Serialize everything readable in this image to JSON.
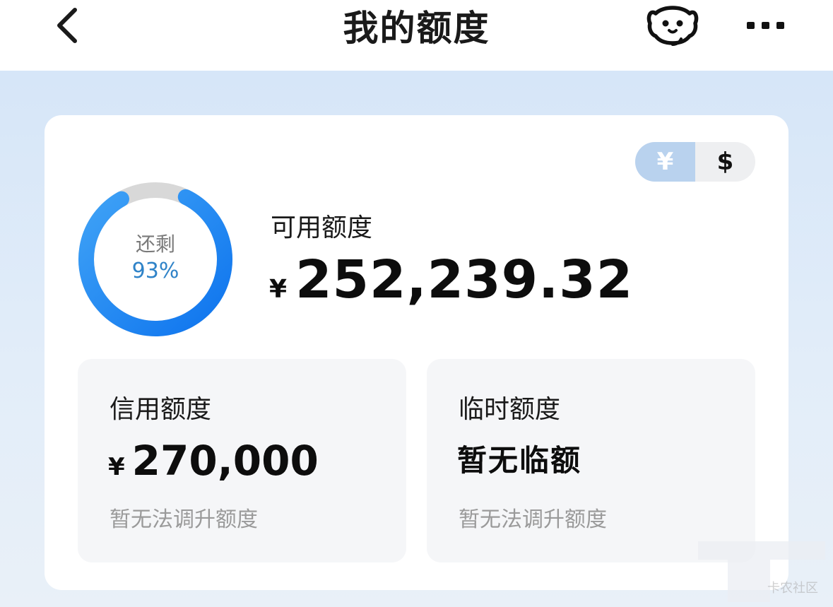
{
  "navbar": {
    "title": "我的额度",
    "back_icon": "chevron-left-icon",
    "service_icon": "customer-service-icon",
    "more_icon": "more-dots-icon"
  },
  "currency_toggle": {
    "options": [
      "¥",
      "$"
    ],
    "selected": "¥"
  },
  "usage_ring": {
    "label": "还剩",
    "percent_text": "93%",
    "remaining_fraction": 0.93,
    "progress_color": "#1f8af2",
    "track_color": "#d8d8d8"
  },
  "available": {
    "label": "可用额度",
    "currency": "¥",
    "amount": "252,239.32"
  },
  "credit_limit": {
    "label": "信用额度",
    "currency": "¥",
    "amount": "270,000",
    "hint": "暂无法调升额度"
  },
  "temp_limit": {
    "label": "临时额度",
    "value": "暂无临额",
    "hint": "暂无法调升额度"
  },
  "watermark": "卡农社区",
  "colors": {
    "accent": "#1f8af2",
    "toggle_active": "#b9d2ee",
    "background": "#d9e8f9"
  }
}
